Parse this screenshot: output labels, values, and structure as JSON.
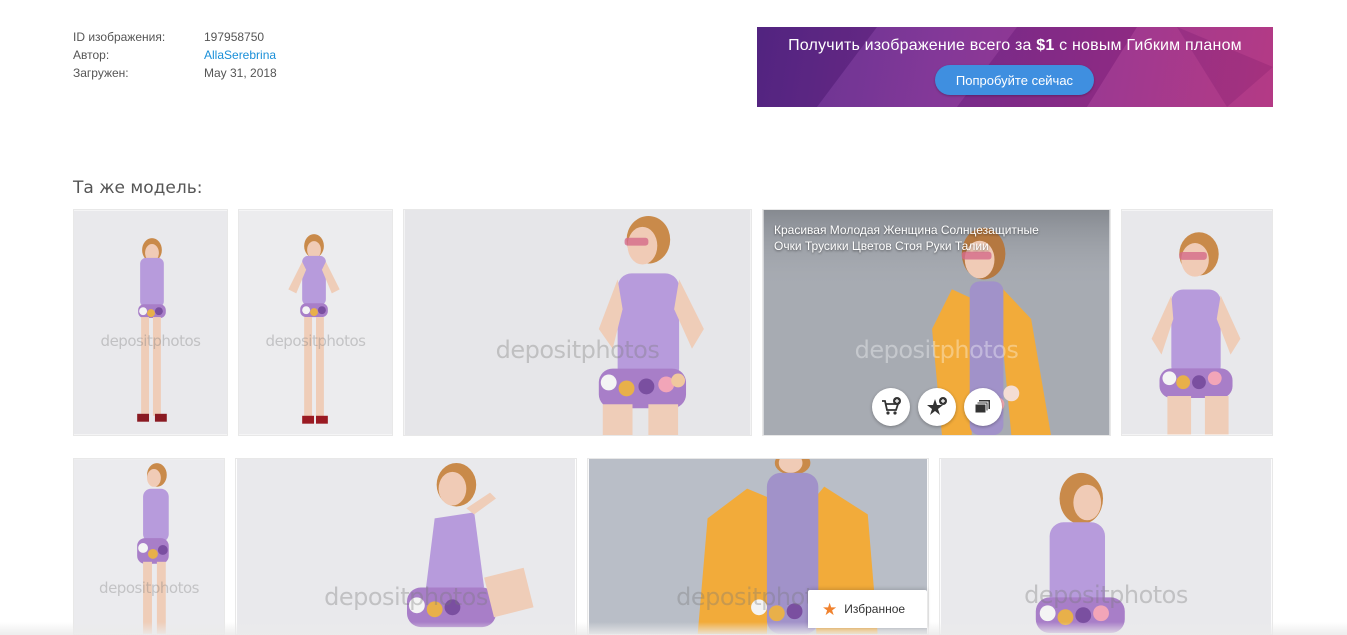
{
  "meta": {
    "id_label": "ID изображения:",
    "id_value": "197958750",
    "author_label": "Автор:",
    "author_value": "AllaSerebrina",
    "uploaded_label": "Загружен:",
    "uploaded_value": "May 31, 2018"
  },
  "promo": {
    "title_prefix": "Получить изображение всего за",
    "title_price": "$1",
    "title_suffix": "с новым Гибким планом",
    "button_label": "Попробуйте сейчас"
  },
  "section": {
    "title": "Та же модель:"
  },
  "watermark": "depositphotos",
  "hovered_thumbnail": {
    "caption": "Красивая Молодая Женщина Солнцезащитные Очки Трусики Цветов Стоя Руки Талии",
    "actions": [
      "add-to-cart-icon",
      "add-to-favorites-icon",
      "view-similar-icon"
    ]
  },
  "favorites_tab": {
    "label": "Избранное",
    "icon": "star-icon"
  },
  "colors": {
    "link": "#1a8fd8",
    "promo_button": "#3f8fe0",
    "bodysuit": "#b79bdc",
    "jacket": "#f2ab3a",
    "favorites_star": "#f0822e"
  }
}
